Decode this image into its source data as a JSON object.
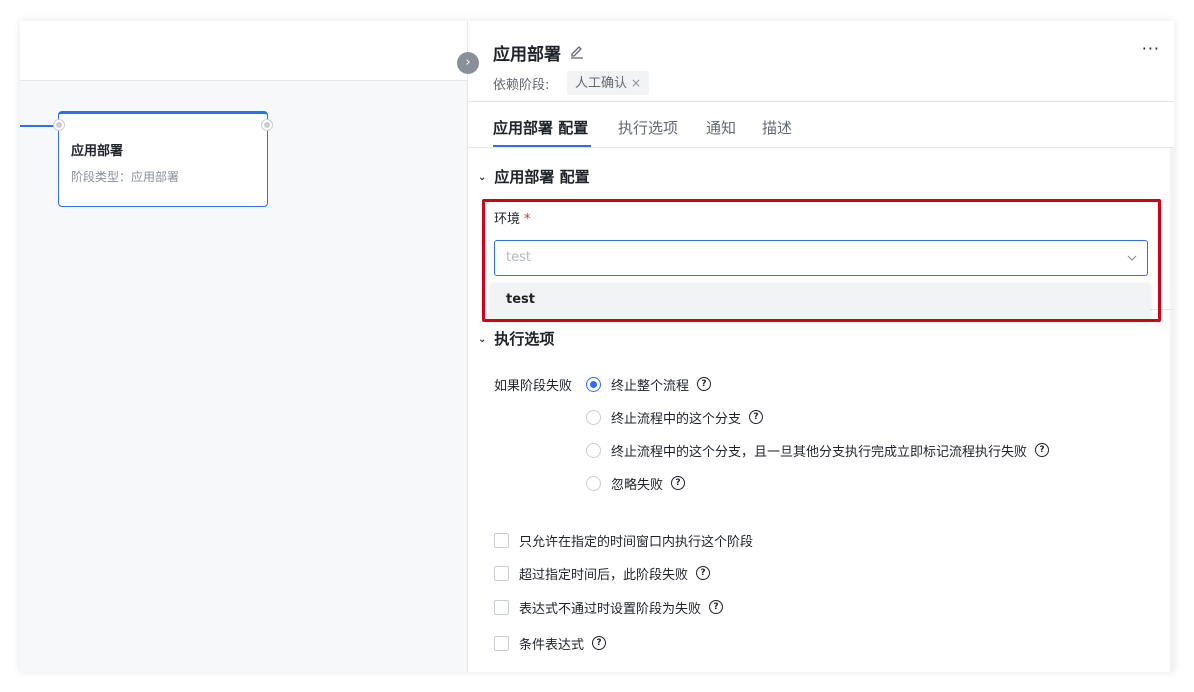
{
  "canvas": {
    "stage": {
      "title": "应用部署",
      "subtitle_label": "阶段类型：",
      "subtitle_value": "应用部署"
    }
  },
  "panel": {
    "title": "应用部署",
    "more": "···",
    "dependency_label": "依赖阶段:",
    "dependency_tag": "人工确认",
    "dependency_tag_close": "×",
    "collapse_glyph": "›",
    "tabs": [
      {
        "label": "应用部署 配置",
        "active": true
      },
      {
        "label": "执行选项",
        "active": false
      },
      {
        "label": "通知",
        "active": false
      },
      {
        "label": "描述",
        "active": false
      }
    ],
    "config_section": {
      "title": "应用部署 配置",
      "env_label": "环境",
      "required_mark": "*",
      "env_placeholder": "test",
      "env_options": [
        "test"
      ]
    },
    "exec_section": {
      "title": "执行选项",
      "fail_label": "如果阶段失败",
      "fail_options": [
        {
          "label": "终止整个流程",
          "checked": true
        },
        {
          "label": "终止流程中的这个分支",
          "checked": false
        },
        {
          "label": "终止流程中的这个分支，且一旦其他分支执行完成立即标记流程执行失败",
          "checked": false
        },
        {
          "label": "忽略失败",
          "checked": false
        }
      ],
      "checkboxes": [
        {
          "label": "只允许在指定的时间窗口内执行这个阶段",
          "help": false
        },
        {
          "label": "超过指定时间后，此阶段失败",
          "help": true
        },
        {
          "label": "表达式不通过时设置阶段为失败",
          "help": true
        },
        {
          "label": "条件表达式",
          "help": true
        }
      ]
    }
  },
  "colors": {
    "accent": "#2f6fed",
    "highlight": "#d0021b",
    "required": "#e02828"
  }
}
